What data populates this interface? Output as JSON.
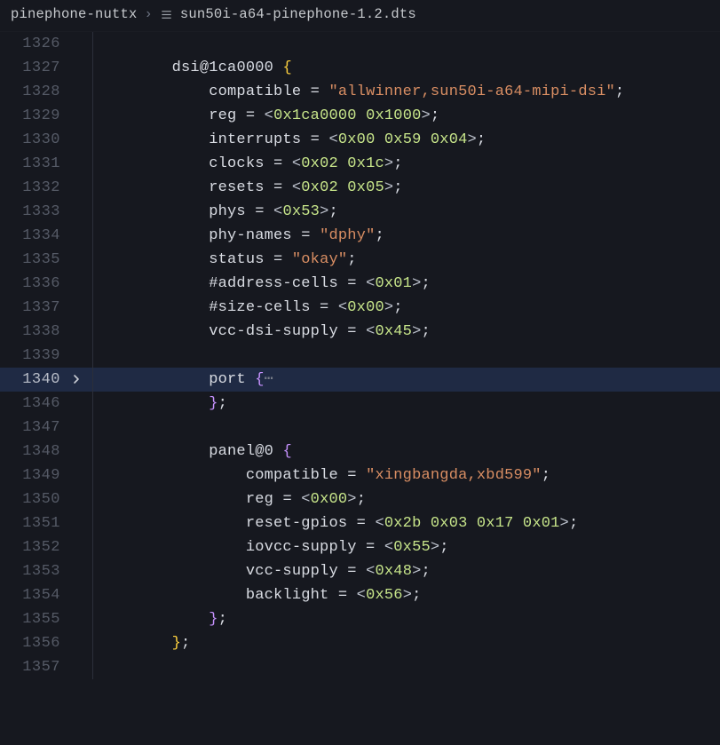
{
  "breadcrumb": {
    "folder": "pinephone-nuttx",
    "separator": "›",
    "file": "sun50i-a64-pinephone-1.2.dts"
  },
  "lines": {
    "l1326": "1326",
    "l1327": "1327",
    "l1328": "1328",
    "l1329": "1329",
    "l1330": "1330",
    "l1331": "1331",
    "l1332": "1332",
    "l1333": "1333",
    "l1334": "1334",
    "l1335": "1335",
    "l1336": "1336",
    "l1337": "1337",
    "l1338": "1338",
    "l1339": "1339",
    "l1340": "1340",
    "l1346": "1346",
    "l1347": "1347",
    "l1348": "1348",
    "l1349": "1349",
    "l1350": "1350",
    "l1351": "1351",
    "l1352": "1352",
    "l1353": "1353",
    "l1354": "1354",
    "l1355": "1355",
    "l1356": "1356",
    "l1357": "1357"
  },
  "code": {
    "dsi_name": "dsi",
    "dsi_at": "@",
    "dsi_addr": "1ca0000",
    "brace_open": "{",
    "brace_close": "}",
    "semi": ";",
    "eq": " = ",
    "lt": "<",
    "gt": ">",
    "compatible_key": "compatible",
    "compatible_val": "\"allwinner,sun50i-a64-mipi-dsi\"",
    "reg_key": "reg",
    "reg_val1": "0x1ca0000",
    "reg_val2": "0x1000",
    "interrupts_key": "interrupts",
    "int_v1": "0x00",
    "int_v2": "0x59",
    "int_v3": "0x04",
    "clocks_key": "clocks",
    "clk_v1": "0x02",
    "clk_v2": "0x1c",
    "resets_key": "resets",
    "rst_v1": "0x02",
    "rst_v2": "0x05",
    "phys_key": "phys",
    "phys_v1": "0x53",
    "phy_names_key": "phy-names",
    "phy_names_val": "\"dphy\"",
    "status_key": "status",
    "status_val": "\"okay\"",
    "addr_cells_key": "#address-cells",
    "addr_cells_v": "0x01",
    "size_cells_key": "#size-cells",
    "size_cells_v": "0x00",
    "vcc_dsi_key": "vcc-dsi-supply",
    "vcc_dsi_v": "0x45",
    "port_key": "port",
    "fold_dots": "⋯",
    "panel_key": "panel",
    "panel_at": "@",
    "panel_addr": "0",
    "panel_compat_val": "\"xingbangda,xbd599\"",
    "panel_reg_v": "0x00",
    "reset_gpios_key": "reset-gpios",
    "rg_v1": "0x2b",
    "rg_v2": "0x03",
    "rg_v3": "0x17",
    "rg_v4": "0x01",
    "iovcc_key": "iovcc-supply",
    "iovcc_v": "0x55",
    "vcc_supply_key": "vcc-supply",
    "vcc_supply_v": "0x48",
    "backlight_key": "backlight",
    "backlight_v": "0x56"
  }
}
